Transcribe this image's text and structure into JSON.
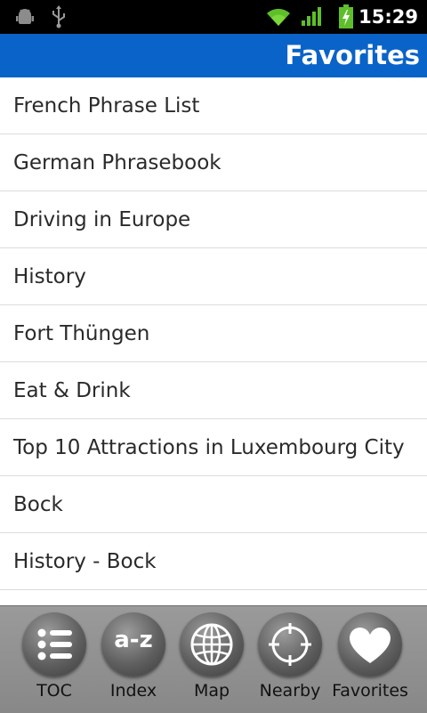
{
  "status_bar": {
    "time": "15:29",
    "icons": [
      "android-debug-icon",
      "usb-icon",
      "wifi-icon",
      "signal-icon",
      "battery-charging-icon"
    ]
  },
  "header": {
    "title": "Favorites"
  },
  "favorites": [
    "French Phrase List",
    "German Phrasebook",
    "Driving in Europe",
    "History",
    "Fort Thüngen",
    "Eat & Drink",
    "Top 10 Attractions in Luxembourg City",
    "Bock",
    "History - Bock"
  ],
  "bottom_nav": [
    {
      "label": "TOC",
      "icon": "list-icon"
    },
    {
      "label": "Index",
      "icon": "a-z-icon",
      "icon_text": "a-z"
    },
    {
      "label": "Map",
      "icon": "globe-icon"
    },
    {
      "label": "Nearby",
      "icon": "crosshair-icon"
    },
    {
      "label": "Favorites",
      "icon": "heart-icon"
    }
  ],
  "colors": {
    "header_bg": "#0a63c8",
    "status_bg": "#000000",
    "nav_bg": "#8f8f8f"
  }
}
